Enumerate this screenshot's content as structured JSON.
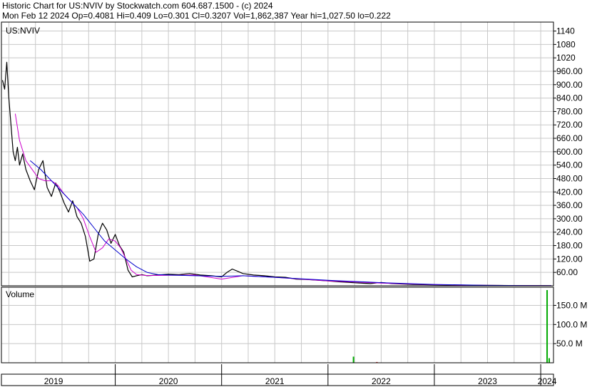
{
  "header": {
    "line1": "Historic Chart for US:NVIV by Stockwatch.com 604.687.1500 - (c) 2024",
    "line2": "Mon Feb 12 2024   Op=0.4081   Hi=0.409   Lo=0.301   Cl=0.3207   Vol=1,862,387   Year hi=1,027.50   lo=0.222"
  },
  "chart_data": {
    "type": "line",
    "symbol_label": "US:NVIV",
    "volume_label": "Volume",
    "colors": {
      "price": "#000000",
      "ma_short": "#cc00cc",
      "ma_long": "#0000cc",
      "volume_up": "#00aa00",
      "volume_down": "#cc0000",
      "grid": "#c8c8c8",
      "frame": "#000000"
    },
    "price_axis": {
      "ticks": [
        60,
        120,
        180,
        240,
        300,
        360,
        420,
        480,
        540,
        600,
        660,
        720,
        780,
        840,
        900,
        960,
        1020,
        1080,
        1140
      ],
      "tick_labels": [
        "60.00",
        "120.00",
        "180.00",
        "240.00",
        "300.00",
        "360.00",
        "420.00",
        "480.00",
        "540.00",
        "600.00",
        "660.00",
        "720.00",
        "780.00",
        "840.00",
        "900.00",
        "960.00",
        "1020",
        "1080",
        "1140"
      ],
      "ylim": [
        0,
        1180
      ]
    },
    "volume_axis": {
      "ticks": [
        50,
        100,
        150
      ],
      "tick_labels": [
        "50.0 M",
        "100.0 M",
        "150.0 M"
      ],
      "ylim": [
        0,
        190
      ]
    },
    "x_axis": {
      "xlim": [
        2018.93,
        2024.12
      ],
      "year_labels": [
        "2019",
        "2020",
        "2021",
        "2022",
        "2023",
        "2024"
      ],
      "year_label_x": [
        2019.42,
        2020.5,
        2021.5,
        2022.5,
        2023.5,
        2024.06
      ],
      "gridlines": [
        2019.0,
        2019.25,
        2019.5,
        2019.75,
        2020.0,
        2020.25,
        2020.5,
        2020.75,
        2021.0,
        2021.25,
        2021.5,
        2021.75,
        2022.0,
        2022.25,
        2022.5,
        2022.75,
        2023.0,
        2023.25,
        2023.5,
        2023.75,
        2024.0
      ],
      "year_boundaries": [
        2020.0,
        2021.0,
        2022.0,
        2023.0,
        2024.0
      ]
    },
    "series": [
      {
        "key": "price",
        "x": [
          2018.94,
          2018.96,
          2018.98,
          2019.0,
          2019.02,
          2019.04,
          2019.06,
          2019.08,
          2019.1,
          2019.13,
          2019.16,
          2019.2,
          2019.24,
          2019.28,
          2019.32,
          2019.36,
          2019.4,
          2019.44,
          2019.48,
          2019.52,
          2019.56,
          2019.6,
          2019.64,
          2019.68,
          2019.72,
          2019.76,
          2019.8,
          2019.84,
          2019.88,
          2019.92,
          2019.96,
          2020.0,
          2020.04,
          2020.08,
          2020.12,
          2020.16,
          2020.2,
          2020.25,
          2020.3,
          2020.4,
          2020.5,
          2020.6,
          2020.7,
          2020.8,
          2020.9,
          2021.0,
          2021.05,
          2021.1,
          2021.15,
          2021.2,
          2021.3,
          2021.4,
          2021.5,
          2021.6,
          2021.7,
          2021.8,
          2021.9,
          2022.0,
          2022.1,
          2022.2,
          2022.3,
          2022.4,
          2022.5,
          2022.6,
          2022.7,
          2022.8,
          2022.9,
          2023.0,
          2023.2,
          2023.4,
          2023.6,
          2023.8,
          2024.0,
          2024.1
        ],
        "y": [
          920,
          880,
          1000,
          840,
          720,
          600,
          560,
          620,
          540,
          590,
          520,
          470,
          430,
          520,
          560,
          440,
          400,
          460,
          420,
          370,
          330,
          380,
          310,
          280,
          220,
          110,
          120,
          230,
          280,
          250,
          190,
          230,
          180,
          150,
          70,
          40,
          45,
          50,
          45,
          48,
          52,
          50,
          55,
          48,
          45,
          40,
          60,
          75,
          65,
          55,
          48,
          45,
          40,
          38,
          30,
          28,
          25,
          22,
          18,
          15,
          12,
          10,
          15,
          10,
          8,
          6,
          5,
          4,
          3,
          2,
          1.5,
          1,
          0.8,
          0.32
        ]
      },
      {
        "key": "ma_short",
        "x": [
          2019.06,
          2019.1,
          2019.16,
          2019.22,
          2019.28,
          2019.34,
          2019.4,
          2019.46,
          2019.52,
          2019.58,
          2019.64,
          2019.7,
          2019.76,
          2019.82,
          2019.88,
          2019.94,
          2020.0,
          2020.05,
          2020.1,
          2020.15,
          2020.2,
          2020.3,
          2020.5,
          2020.75,
          2021.0,
          2021.2,
          2021.5,
          2022.0,
          2022.5,
          2023.0,
          2023.5,
          2024.0,
          2024.1
        ],
        "y": [
          770,
          650,
          560,
          520,
          480,
          470,
          470,
          450,
          410,
          380,
          350,
          300,
          220,
          150,
          170,
          210,
          200,
          170,
          120,
          70,
          50,
          46,
          47,
          48,
          30,
          45,
          38,
          22,
          12,
          5,
          2,
          1,
          0.5
        ]
      },
      {
        "key": "ma_long",
        "x": [
          2019.2,
          2019.3,
          2019.4,
          2019.5,
          2019.6,
          2019.7,
          2019.8,
          2019.9,
          2020.0,
          2020.1,
          2020.2,
          2020.3,
          2020.4,
          2020.5,
          2020.6,
          2020.75,
          2021.0,
          2021.2,
          2021.5,
          2022.0,
          2022.5,
          2023.0,
          2023.5,
          2024.0,
          2024.1
        ],
        "y": [
          560,
          520,
          470,
          420,
          370,
          320,
          260,
          200,
          160,
          120,
          85,
          60,
          50,
          48,
          47,
          45,
          42,
          45,
          38,
          25,
          14,
          6,
          2,
          1,
          0.5
        ]
      },
      {
        "key": "volume",
        "x": [
          2022.24,
          2022.46,
          2024.06,
          2024.08
        ],
        "y": [
          16,
          2,
          190,
          12
        ],
        "up": [
          true,
          false,
          true,
          true
        ]
      }
    ]
  }
}
